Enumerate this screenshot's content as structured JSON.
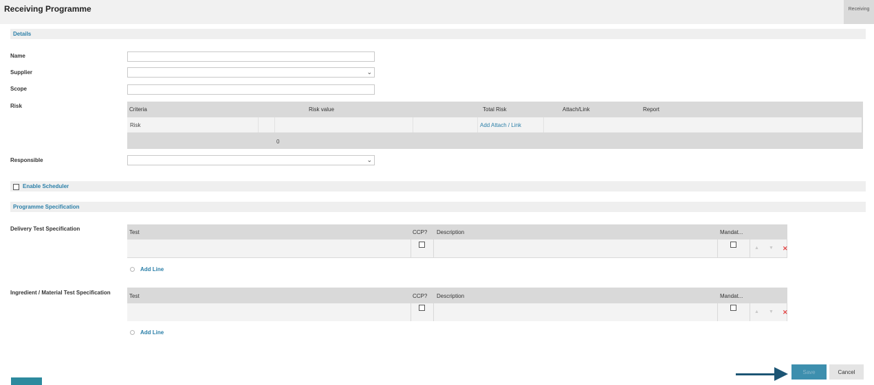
{
  "page": {
    "title": "Receiving Programme",
    "top_tab": "Receiving"
  },
  "details": {
    "section_label": "Details",
    "name_label": "Name",
    "supplier_label": "Supplier",
    "scope_label": "Scope",
    "risk_label": "Risk",
    "responsible_label": "Responsible"
  },
  "risk_table": {
    "headers": [
      "Criteria",
      "Risk value",
      "Total Risk",
      "Attach/Link",
      "Report"
    ],
    "row": {
      "criteria": "Risk",
      "attach_link": "Add Attach / Link"
    },
    "total": "0"
  },
  "scheduler": {
    "label": "Enable Scheduler",
    "checked": false
  },
  "programme_spec": {
    "section_label": "Programme Specification",
    "tables": [
      {
        "label": "Delivery Test Specification",
        "headers": {
          "test": "Test",
          "ccp": "CCP?",
          "description": "Description",
          "mandatory": "Mandat..."
        },
        "add_line": "Add Line"
      },
      {
        "label": "Ingredient / Material Test Specification",
        "headers": {
          "test": "Test",
          "ccp": "CCP?",
          "description": "Description",
          "mandatory": "Mandat..."
        },
        "add_line": "Add Line"
      }
    ]
  },
  "icons": {
    "up": "▲",
    "down": "▼",
    "delete": "✕",
    "select_arrow": "⌄"
  },
  "footer": {
    "save_label": "Save",
    "cancel_label": "Cancel"
  },
  "colors": {
    "accent": "#2b7fa8",
    "save_bg": "#3d8fae",
    "arrow": "#1c5574",
    "delete": "#e34747"
  }
}
